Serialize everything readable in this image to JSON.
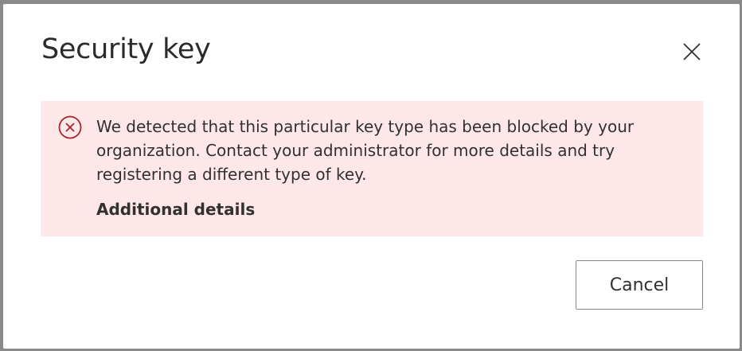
{
  "dialog": {
    "title": "Security key",
    "close_icon": "close-icon"
  },
  "error": {
    "icon": "error-circle-icon",
    "message": "We detected that this particular key type has been blocked by your organization. Contact your administrator for more details and try registering a different type of key.",
    "details_label": "Additional details",
    "background_color": "#fde7e9",
    "icon_color": "#a4262c"
  },
  "actions": {
    "cancel_label": "Cancel"
  }
}
